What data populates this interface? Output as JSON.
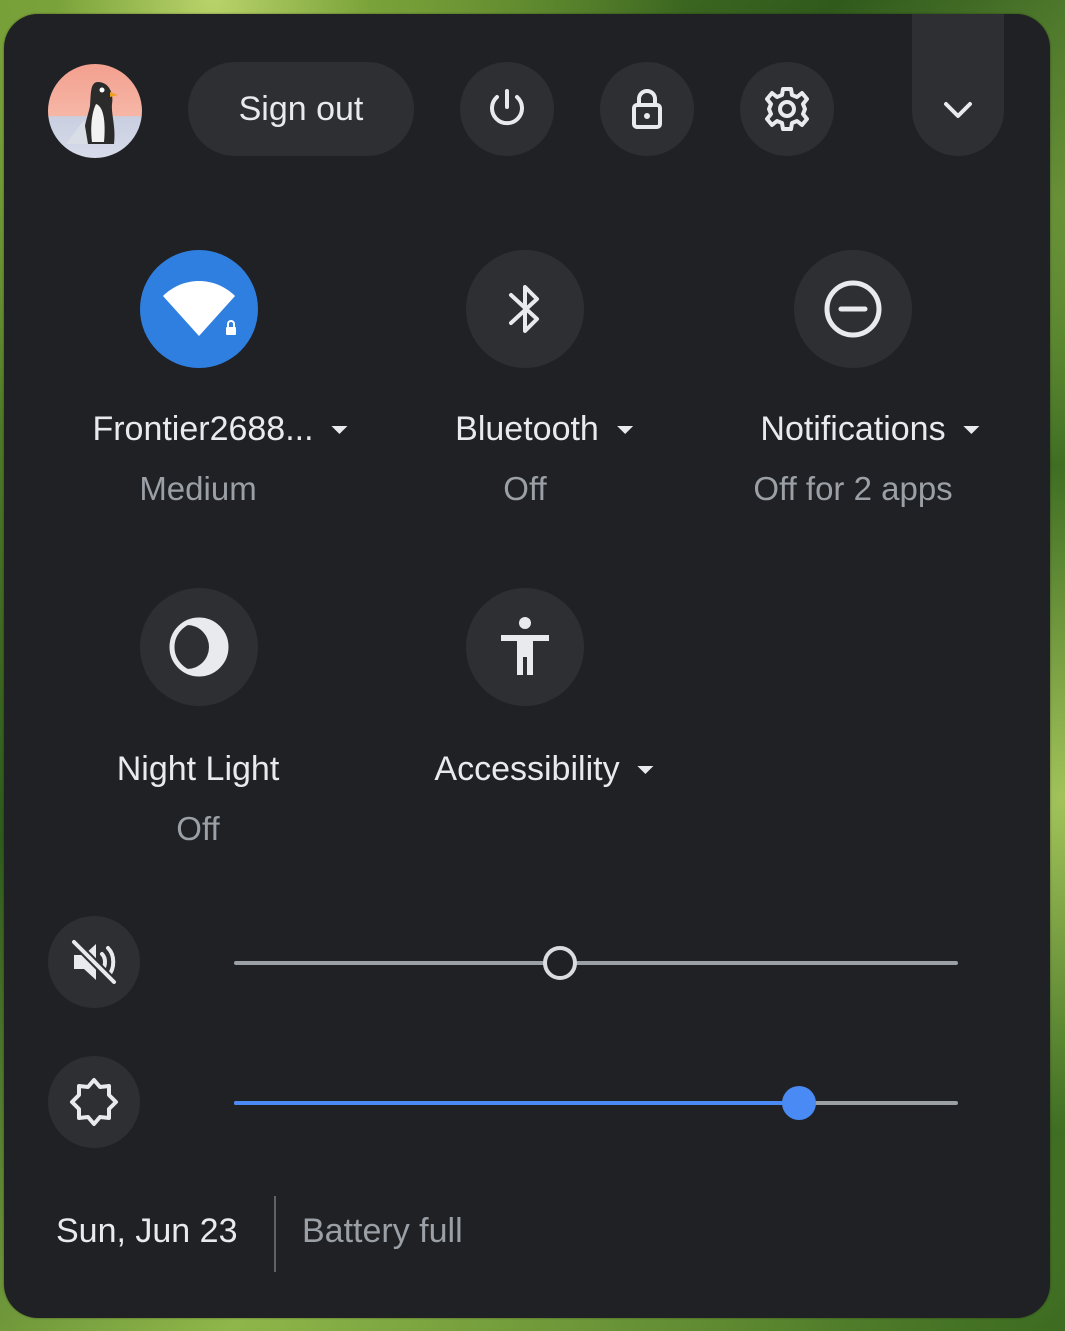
{
  "header": {
    "sign_out_label": "Sign out",
    "icons": [
      "avatar",
      "power-icon",
      "lock-icon",
      "settings-icon",
      "chevron-down-icon"
    ]
  },
  "tiles": [
    {
      "name": "network",
      "label": "Frontier2688...",
      "sub": "Medium",
      "active": true,
      "icon": "wifi-locked-icon",
      "dropdown": true
    },
    {
      "name": "bluetooth",
      "label": "Bluetooth",
      "sub": "Off",
      "active": false,
      "icon": "bluetooth-icon",
      "dropdown": true
    },
    {
      "name": "notifications",
      "label": "Notifications",
      "sub": "Off for 2 apps",
      "active": false,
      "icon": "do-not-disturb-icon",
      "dropdown": true
    },
    {
      "name": "night-light",
      "label": "Night Light",
      "sub": "Off",
      "active": false,
      "icon": "night-light-icon",
      "dropdown": false
    },
    {
      "name": "accessibility",
      "label": "Accessibility",
      "sub": "",
      "active": false,
      "icon": "accessibility-icon",
      "dropdown": true
    }
  ],
  "sliders": {
    "volume": {
      "icon": "volume-muted-icon",
      "value": 0.45,
      "muted": true
    },
    "brightness": {
      "icon": "brightness-icon",
      "value": 0.78
    }
  },
  "footer": {
    "date": "Sun, Jun 23",
    "battery": "Battery full"
  },
  "colors": {
    "panel": "#202124",
    "button": "#2d2f33",
    "accent": "#4a8af4",
    "text": "#e8eaed",
    "subtext": "#9aa0a6"
  }
}
